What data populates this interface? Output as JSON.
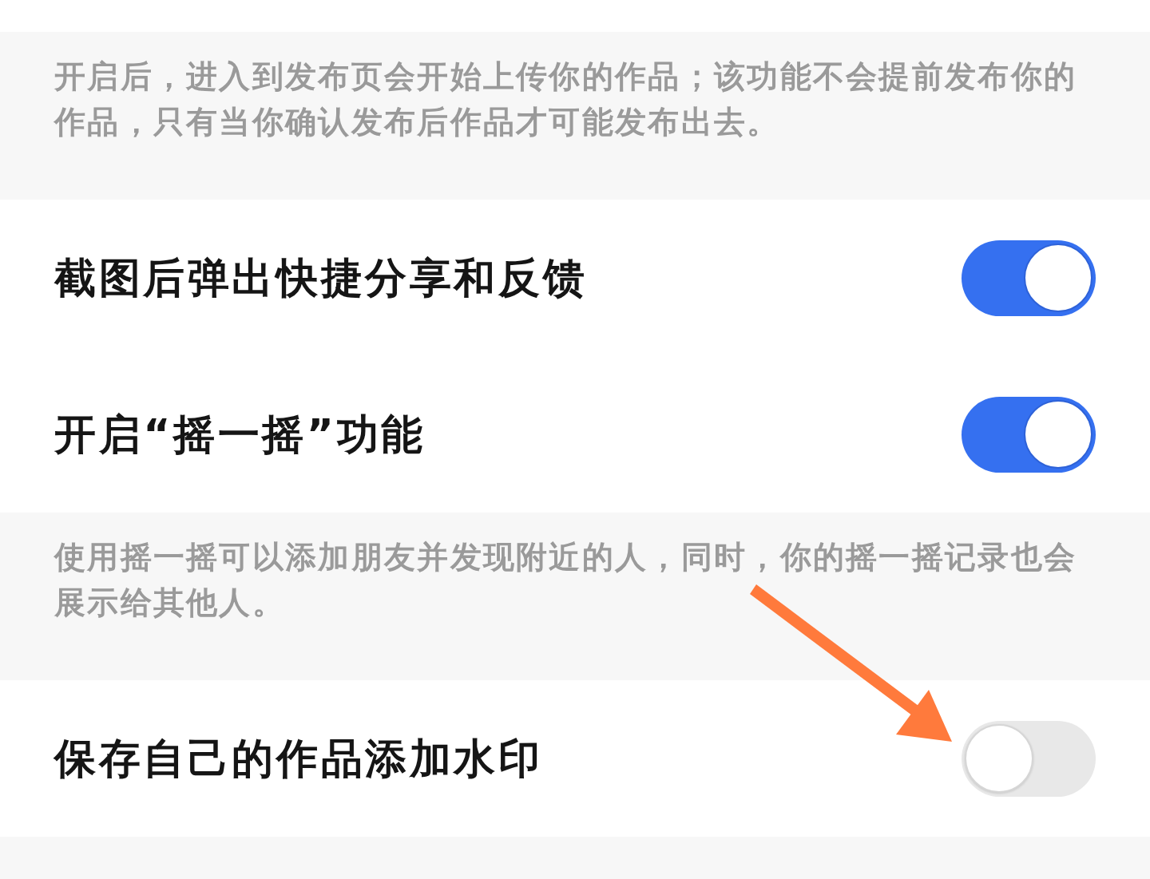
{
  "sections": [
    {
      "kind": "note",
      "text": "开启后，进入到发布页会开始上传你的作品；该功能不会提前发布你的作品，只有当你确认发布后作品才可能发布出去。"
    },
    {
      "kind": "switch",
      "label": "截图后弹出快捷分享和反馈",
      "on": true,
      "pointed_at": false
    },
    {
      "kind": "switch",
      "label": "开启“摇一摇”功能",
      "on": true,
      "pointed_at": false
    },
    {
      "kind": "note",
      "text": "使用摇一摇可以添加朋友并发现附近的人，同时，你的摇一摇记录也会展示给其他人。"
    },
    {
      "kind": "switch",
      "label": "保存自己的作品添加水印",
      "on": false,
      "pointed_at": true
    }
  ]
}
